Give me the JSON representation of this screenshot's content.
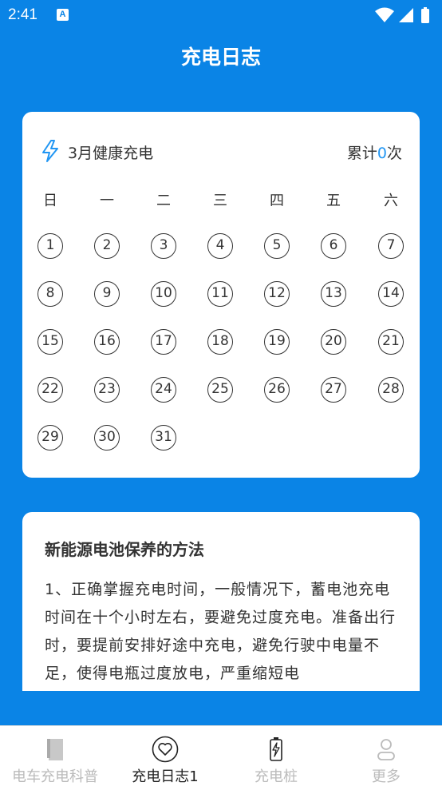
{
  "status": {
    "time": "2:41"
  },
  "header": {
    "title": "充电日志"
  },
  "calendar": {
    "title": "3月健康充电",
    "total_prefix": "累计",
    "total_count": "0",
    "total_suffix": "次",
    "weekdays": [
      "日",
      "一",
      "二",
      "三",
      "四",
      "五",
      "六"
    ],
    "days": [
      "1",
      "2",
      "3",
      "4",
      "5",
      "6",
      "7",
      "8",
      "9",
      "10",
      "11",
      "12",
      "13",
      "14",
      "15",
      "16",
      "17",
      "18",
      "19",
      "20",
      "21",
      "22",
      "23",
      "24",
      "25",
      "26",
      "27",
      "28",
      "29",
      "30",
      "31"
    ]
  },
  "tips": {
    "title": "新能源电池保养的方法",
    "body": "1、正确掌握充电时间，一般情况下，蓄电池充电时间在十个小时左右，要避免过度充电。准备出行时，要提前安排好途中充电，避免行驶中电量不足，使得电瓶过度放电，严重缩短电"
  },
  "tabs": [
    {
      "label": "电车充电科普",
      "icon": "book-icon",
      "active": false
    },
    {
      "label": "充电日志1",
      "icon": "heart-icon",
      "active": true
    },
    {
      "label": "充电桩",
      "icon": "battery-charging-icon",
      "active": false
    },
    {
      "label": "更多",
      "icon": "person-icon",
      "active": false
    }
  ],
  "colors": {
    "primary": "#0a84e6",
    "accent": "#2196f3"
  }
}
